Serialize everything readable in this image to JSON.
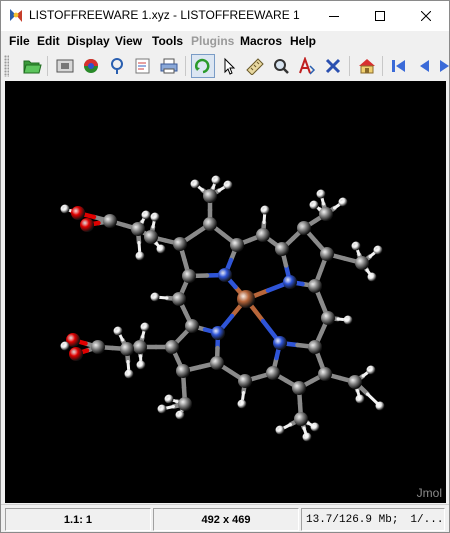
{
  "window": {
    "title": "LISTOFFREEWARE 1.xyz - LISTOFFREEWARE 1"
  },
  "menubar": {
    "items": [
      {
        "label": "File",
        "enabled": true
      },
      {
        "label": "Edit",
        "enabled": true
      },
      {
        "label": "Display",
        "enabled": true
      },
      {
        "label": "View",
        "enabled": true
      },
      {
        "label": "Tools",
        "enabled": true
      },
      {
        "label": "Plugins",
        "enabled": false
      },
      {
        "label": "Macros",
        "enabled": true
      },
      {
        "label": "Help",
        "enabled": true
      }
    ]
  },
  "toolbar": {
    "icons": [
      "open-folder-icon",
      "screenshot-icon",
      "display-colors-icon",
      "info-icon",
      "edit-script-icon",
      "print-icon",
      "rotate-icon",
      "pick-pointer-icon",
      "measure-ruler-icon",
      "search-icon",
      "atom-label-icon",
      "delete-icon",
      "home-icon",
      "first-frame-icon",
      "previous-frame-icon"
    ]
  },
  "viewer": {
    "watermark": "Jmol",
    "background": "#000000",
    "atom_colors": {
      "carbon": "#8a8a8a",
      "hydrogen": "#f2f2f2",
      "nitrogen": "#2f55d8",
      "oxygen": "#e00000",
      "metal": "#b8663a"
    }
  },
  "statusbar": {
    "zoom": "1.1: 1",
    "dimensions": "492 x 469",
    "memory": "13.7/126.9 Mb;",
    "frame": "1/..."
  }
}
